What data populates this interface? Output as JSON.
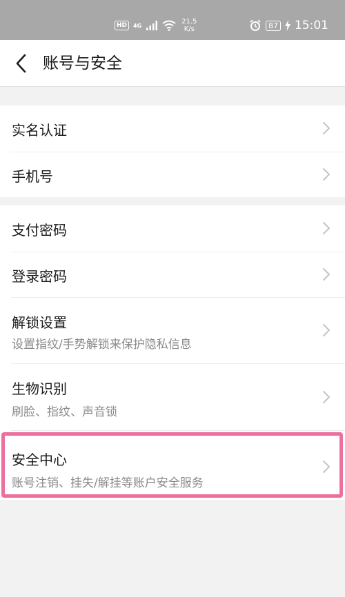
{
  "status_bar": {
    "hd": "HD",
    "network": "4G",
    "network_sub": "⁺",
    "speed_value": "21.5",
    "speed_unit": "K/s",
    "battery": "87",
    "time": "15:01"
  },
  "header": {
    "title": "账号与安全",
    "back_icon": "chevron-left-icon"
  },
  "groups": [
    {
      "items": [
        {
          "title": "实名认证"
        },
        {
          "title": "手机号"
        }
      ]
    },
    {
      "items": [
        {
          "title": "支付密码"
        },
        {
          "title": "登录密码"
        },
        {
          "title": "解锁设置",
          "subtitle": "设置指纹/手势解锁来保护隐私信息"
        },
        {
          "title": "生物识别",
          "subtitle": "刷脸、指纹、声音锁"
        },
        {
          "title": "安全中心",
          "subtitle": "账号注销、挂失/解挂等账户安全服务"
        }
      ]
    }
  ],
  "colors": {
    "status_bar": "#a8a8a8",
    "background": "#f2f2f2",
    "highlight": "#ec6f9e",
    "subtitle": "#8a8a8a"
  }
}
